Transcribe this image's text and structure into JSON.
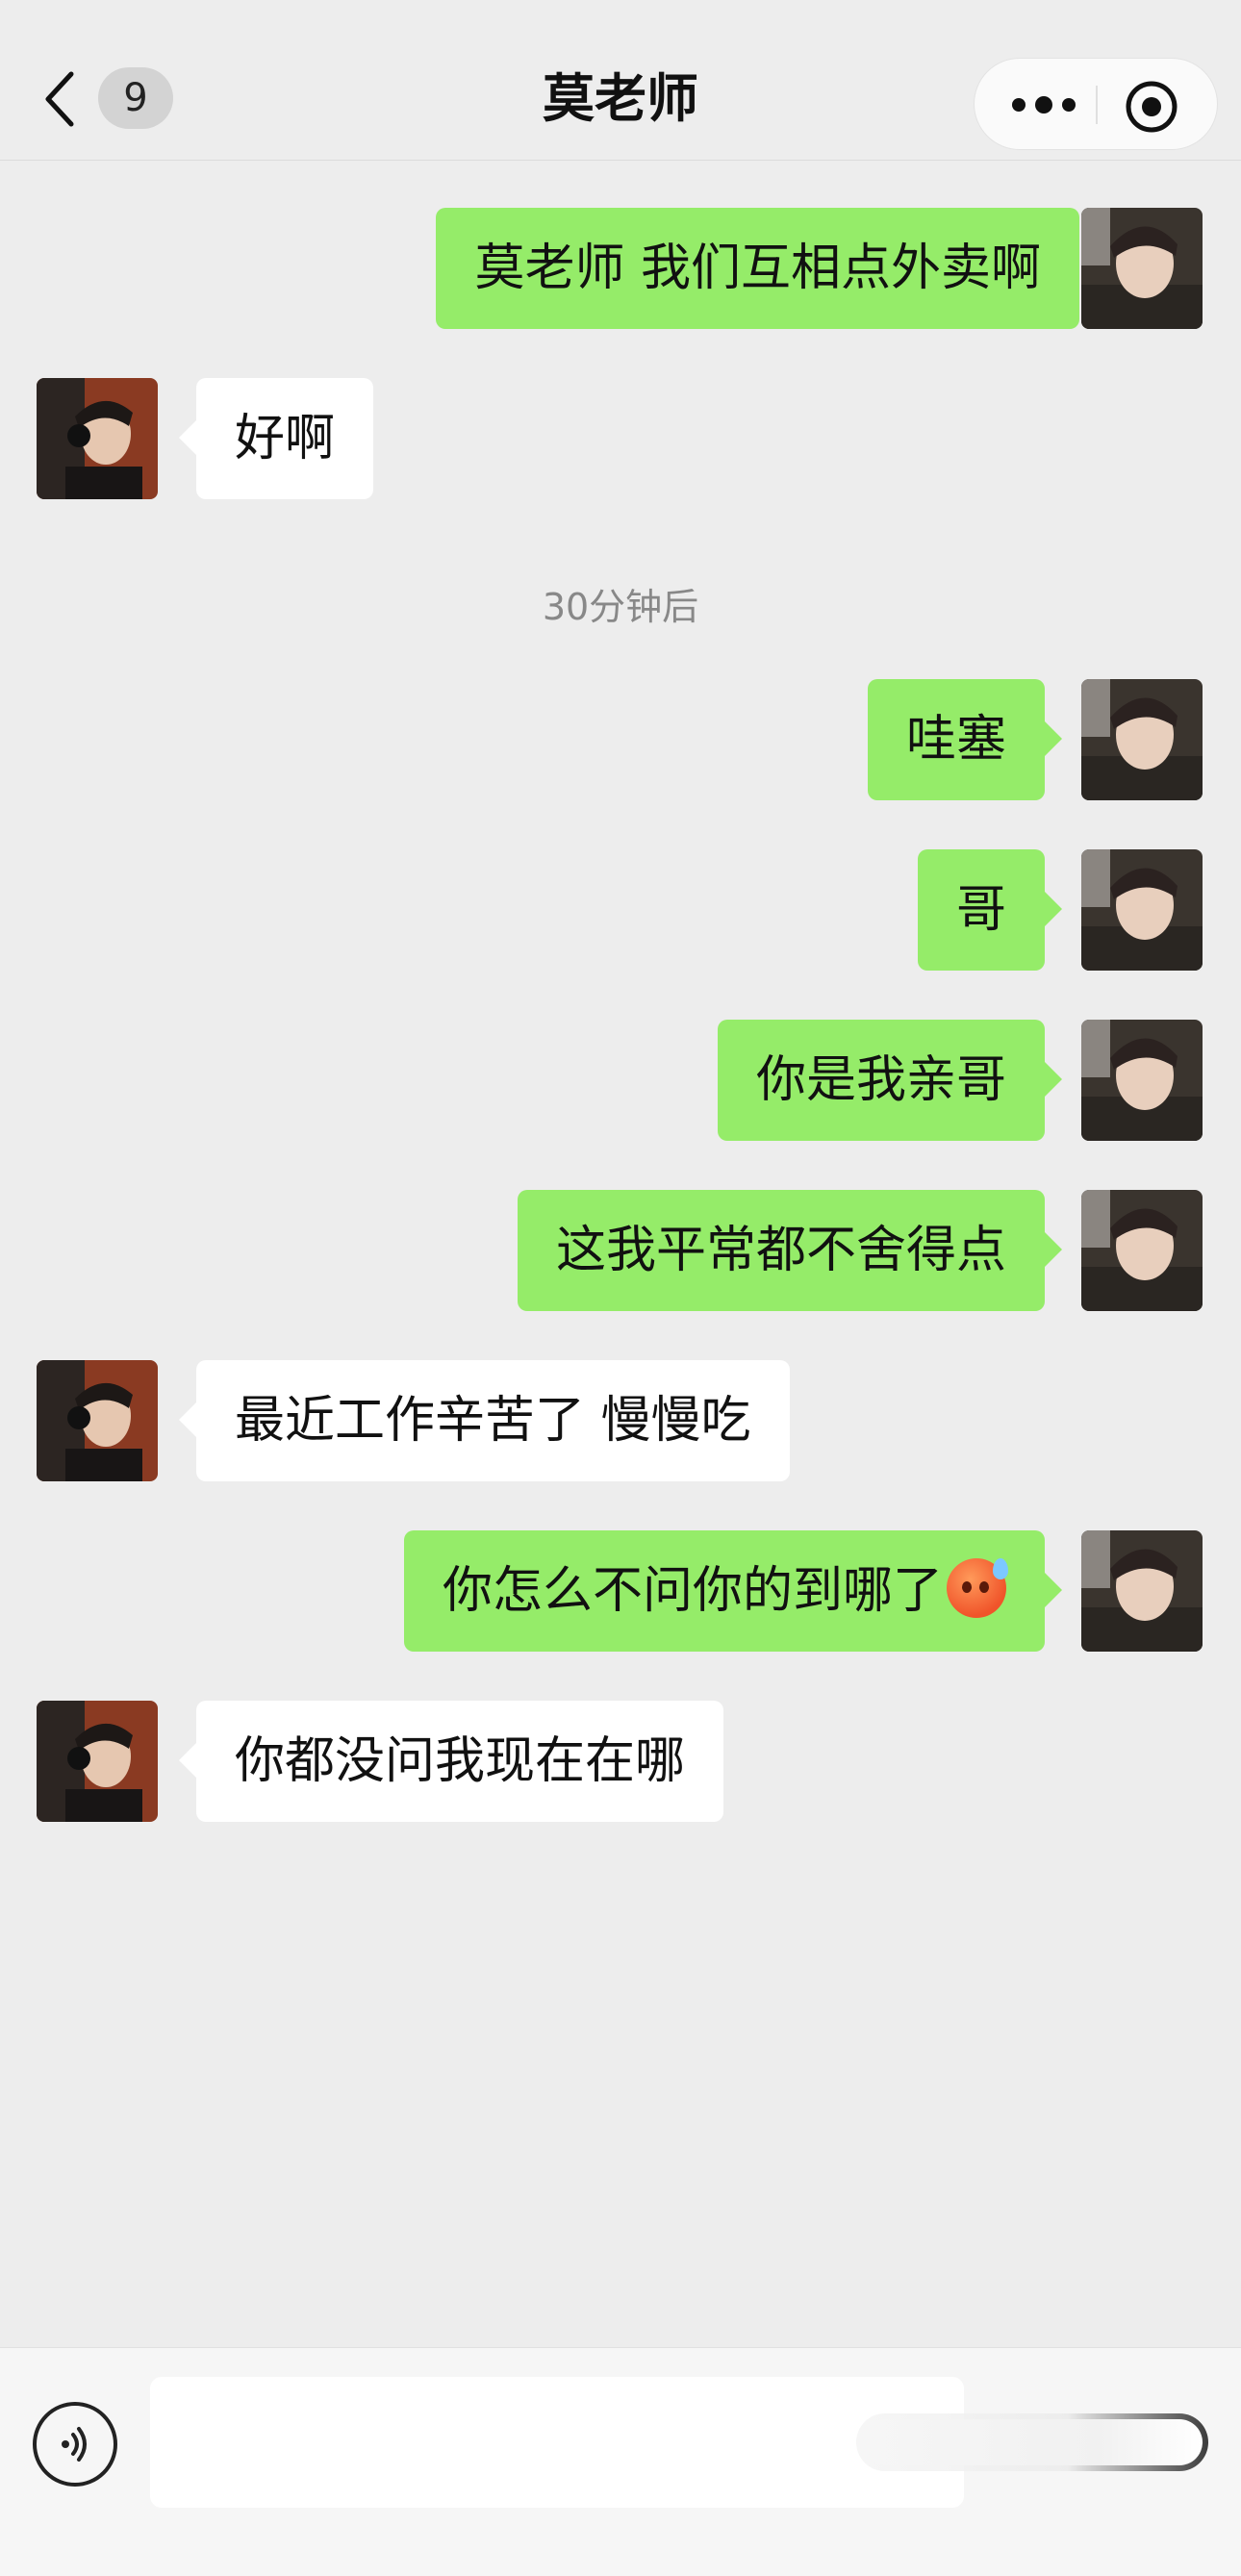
{
  "header": {
    "title": "莫老师",
    "unread_count": "9",
    "icons": [
      "chevron-left-icon",
      "more-dots-icon",
      "target-icon"
    ]
  },
  "messages": [
    {
      "from": "me",
      "text": "莫老师 我们互相点外卖啊"
    },
    {
      "from": "them",
      "text": "好啊"
    },
    {
      "from": "system",
      "text": "30分钟后"
    },
    {
      "from": "me",
      "text": "哇塞"
    },
    {
      "from": "me",
      "text": "哥"
    },
    {
      "from": "me",
      "text": "你是我亲哥"
    },
    {
      "from": "me",
      "text": "这我平常都不舍得点"
    },
    {
      "from": "them",
      "text": "最近工作辛苦了 慢慢吃"
    },
    {
      "from": "me",
      "text": "你怎么不问你的到哪了",
      "emoji": "sweat-face-icon"
    },
    {
      "from": "them",
      "text": "你都没问我现在在哪"
    }
  ],
  "input_bar": {
    "text_value": "",
    "icons": [
      "voice-icon"
    ]
  },
  "colors": {
    "background": "#ededed",
    "my_bubble": "#95ec69",
    "their_bubble": "#ffffff"
  }
}
